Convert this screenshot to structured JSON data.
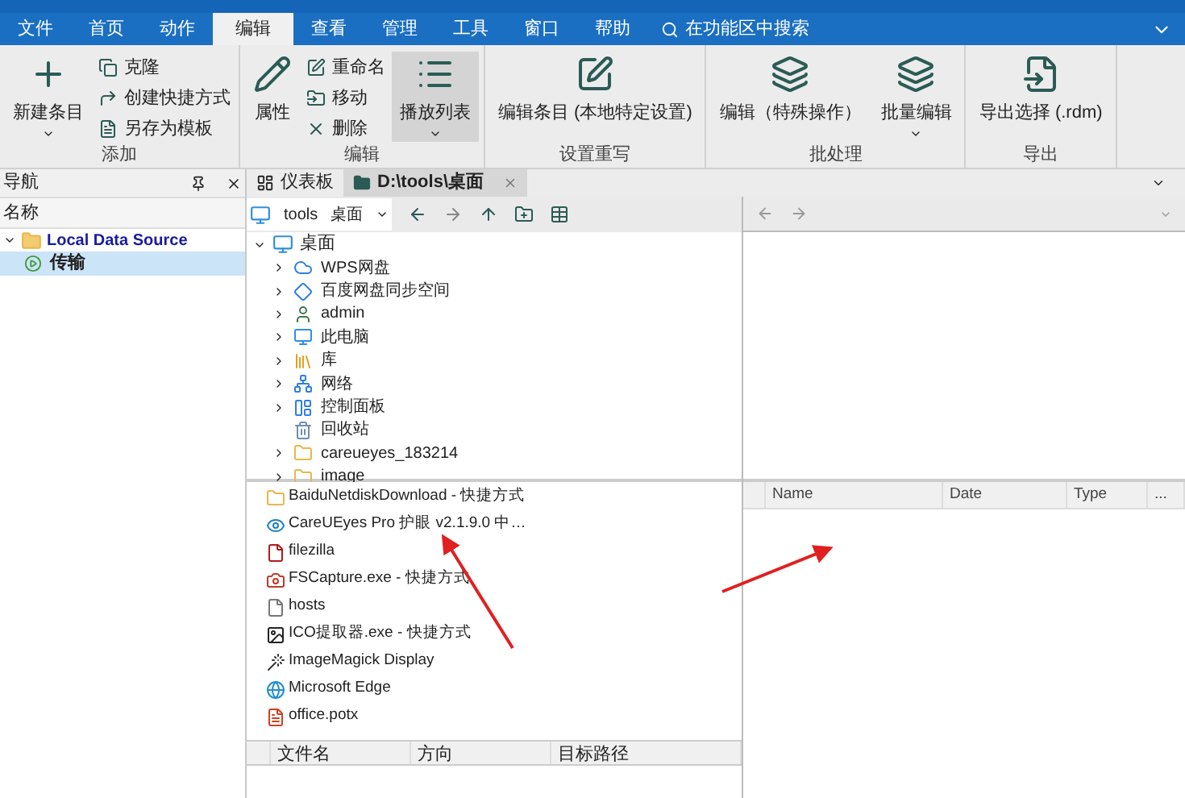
{
  "menu": {
    "tabs": [
      {
        "label": "文件",
        "selected": false
      },
      {
        "label": "首页",
        "selected": false
      },
      {
        "label": "动作",
        "selected": false
      },
      {
        "label": "编辑",
        "selected": true
      },
      {
        "label": "查看",
        "selected": false
      },
      {
        "label": "管理",
        "selected": false
      },
      {
        "label": "工具",
        "selected": false
      },
      {
        "label": "窗口",
        "selected": false
      },
      {
        "label": "帮助",
        "selected": false
      }
    ],
    "search": "在功能区中搜索"
  },
  "ribbon": {
    "groups": [
      {
        "label": "添加",
        "items": [
          {
            "kind": "large",
            "label": "新建条目",
            "dropdown": true,
            "selected": false
          },
          {
            "kind": "stack",
            "items": [
              {
                "label": "克隆"
              },
              {
                "label": "创建快捷方式"
              },
              {
                "label": "另存为模板"
              }
            ]
          }
        ]
      },
      {
        "label": "编辑",
        "items": [
          {
            "kind": "large",
            "label": "属性",
            "dropdown": false,
            "selected": false
          },
          {
            "kind": "stack",
            "items": [
              {
                "label": "重命名"
              },
              {
                "label": "移动"
              },
              {
                "label": "删除"
              }
            ]
          },
          {
            "kind": "large",
            "label": "播放列表",
            "dropdown": true,
            "selected": true
          }
        ]
      },
      {
        "label": "设置重写",
        "items": [
          {
            "kind": "large",
            "label": "编辑条目 (本地特定设置)",
            "dropdown": false,
            "selected": false
          }
        ]
      },
      {
        "label": "批处理",
        "items": [
          {
            "kind": "large",
            "label": "编辑（特殊操作）",
            "dropdown": false,
            "selected": false
          },
          {
            "kind": "large",
            "label": "批量编辑",
            "dropdown": true,
            "selected": false
          }
        ]
      },
      {
        "label": "导出",
        "items": [
          {
            "kind": "large",
            "label": "导出选择 (.rdm)",
            "dropdown": false,
            "selected": false
          }
        ]
      }
    ]
  },
  "navigation": {
    "title": "导航",
    "column": "名称",
    "tree": [
      {
        "label": "Local Data Source",
        "expanded": true,
        "selected": false,
        "children": [
          {
            "label": "传输",
            "selected": true
          }
        ]
      }
    ]
  },
  "document_tabs": [
    {
      "label": "仪表板",
      "selected": false
    },
    {
      "label": "D:\\tools\\桌面",
      "selected": true
    }
  ],
  "breadcrumb": [
    "tools",
    "桌面"
  ],
  "folder_tree": {
    "root": "桌面",
    "items": [
      {
        "label": "WPS网盘",
        "expandable": true
      },
      {
        "label": "百度网盘同步空间",
        "expandable": true
      },
      {
        "label": "admin",
        "expandable": true
      },
      {
        "label": "此电脑",
        "expandable": true
      },
      {
        "label": "库",
        "expandable": true
      },
      {
        "label": "网络",
        "expandable": true
      },
      {
        "label": "控制面板",
        "expandable": true
      },
      {
        "label": "回收站",
        "expandable": false
      },
      {
        "label": "careueyes_183214",
        "expandable": true
      },
      {
        "label": "image",
        "expandable": true
      }
    ]
  },
  "file_list": [
    "BaiduNetdiskDownload - 快捷方式",
    "CareUEyes Pro 护眼 v2.1.9.0 中…",
    "filezilla",
    "FSCapture.exe - 快捷方式",
    "hosts",
    "ICO提取器.exe - 快捷方式",
    "ImageMagick Display",
    "Microsoft Edge",
    "office.potx"
  ],
  "transfer_columns": [
    "文件名",
    "方向",
    "目标路径"
  ],
  "remote_columns": [
    "Name",
    "Date",
    "Type",
    "..."
  ]
}
